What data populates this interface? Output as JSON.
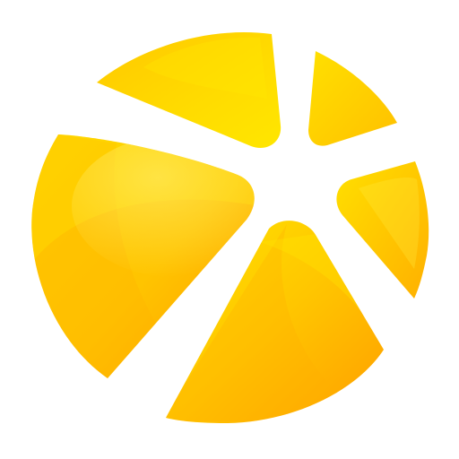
{
  "icon": {
    "name": "citrus-slice-logo-icon",
    "colors": {
      "background": "#ffffff",
      "yellow_light": "#FFE600",
      "yellow": "#FFD400",
      "amber": "#FFB800",
      "orange": "#FF9A00",
      "highlight": "#FFF27A"
    }
  }
}
